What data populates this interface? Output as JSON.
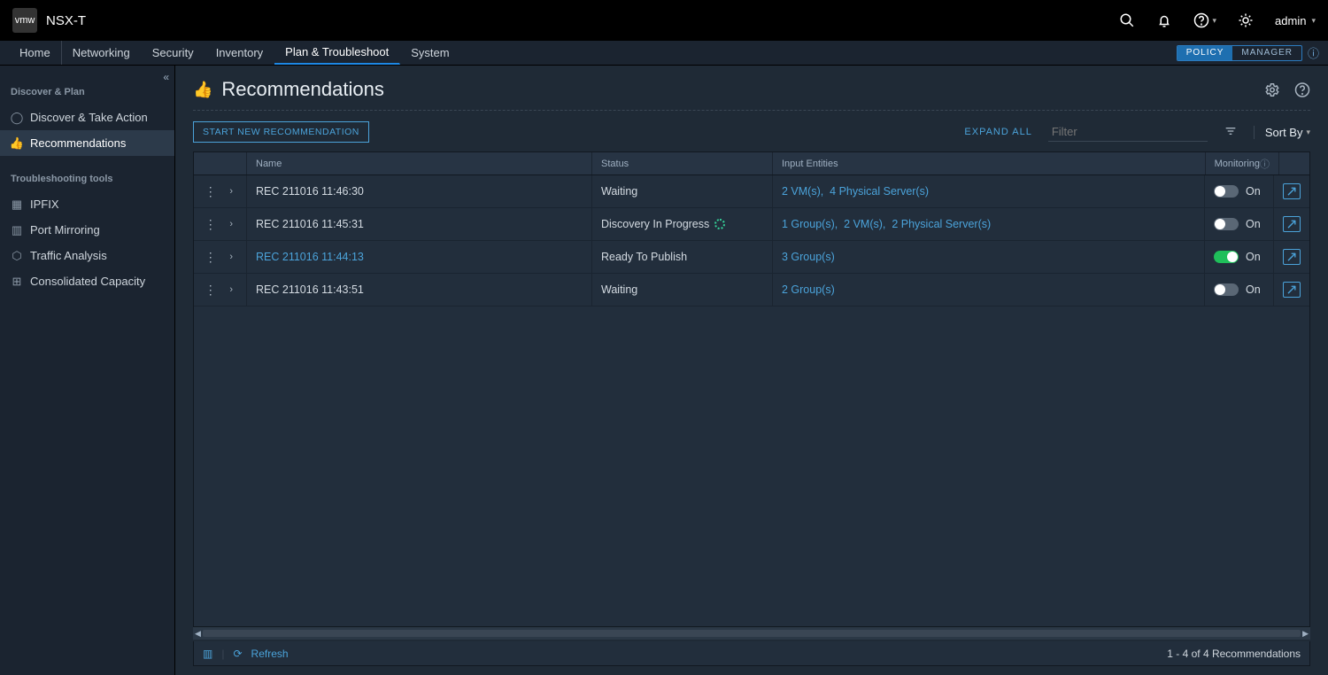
{
  "brand": {
    "logo": "vmw",
    "name": "NSX-T"
  },
  "topbar": {
    "user": "admin"
  },
  "nav": {
    "tabs": [
      "Home",
      "Networking",
      "Security",
      "Inventory",
      "Plan & Troubleshoot",
      "System"
    ],
    "active": 4,
    "mode": {
      "policy": "POLICY",
      "manager": "MANAGER"
    }
  },
  "sidebar": {
    "section1": "Discover & Plan",
    "items1": [
      {
        "icon": "◯",
        "label": "Discover & Take Action"
      },
      {
        "icon": "👍",
        "label": "Recommendations",
        "active": true
      }
    ],
    "section2": "Troubleshooting tools",
    "items2": [
      {
        "icon": "▦",
        "label": "IPFIX"
      },
      {
        "icon": "▥",
        "label": "Port Mirroring"
      },
      {
        "icon": "⬡",
        "label": "Traffic Analysis"
      },
      {
        "icon": "⊞",
        "label": "Consolidated Capacity"
      }
    ]
  },
  "page": {
    "title": "Recommendations",
    "start_btn": "START NEW RECOMMENDATION",
    "expand_all": "EXPAND ALL",
    "filter_ph": "Filter",
    "sort_by": "Sort By",
    "cols": {
      "name": "Name",
      "status": "Status",
      "entities": "Input Entities",
      "monitoring": "Monitoring"
    },
    "rows": [
      {
        "name": "REC 211016 11:46:30",
        "status": "Waiting",
        "status_spinner": false,
        "entities": "2 VM(s),  4 Physical Server(s)",
        "monitor_on": false,
        "mon_label": "On",
        "name_link": false
      },
      {
        "name": "REC 211016 11:45:31",
        "status": "Discovery In Progress",
        "status_spinner": true,
        "entities": "1 Group(s),  2 VM(s),  2 Physical Server(s)",
        "monitor_on": false,
        "mon_label": "On",
        "name_link": false
      },
      {
        "name": "REC 211016 11:44:13",
        "status": "Ready To Publish",
        "status_spinner": false,
        "entities": "3 Group(s)",
        "monitor_on": true,
        "mon_label": "On",
        "name_link": true
      },
      {
        "name": "REC 211016 11:43:51",
        "status": "Waiting",
        "status_spinner": false,
        "entities": "2 Group(s)",
        "monitor_on": false,
        "mon_label": "On",
        "name_link": false
      }
    ],
    "refresh": "Refresh",
    "count": "1 - 4 of 4 Recommendations"
  }
}
